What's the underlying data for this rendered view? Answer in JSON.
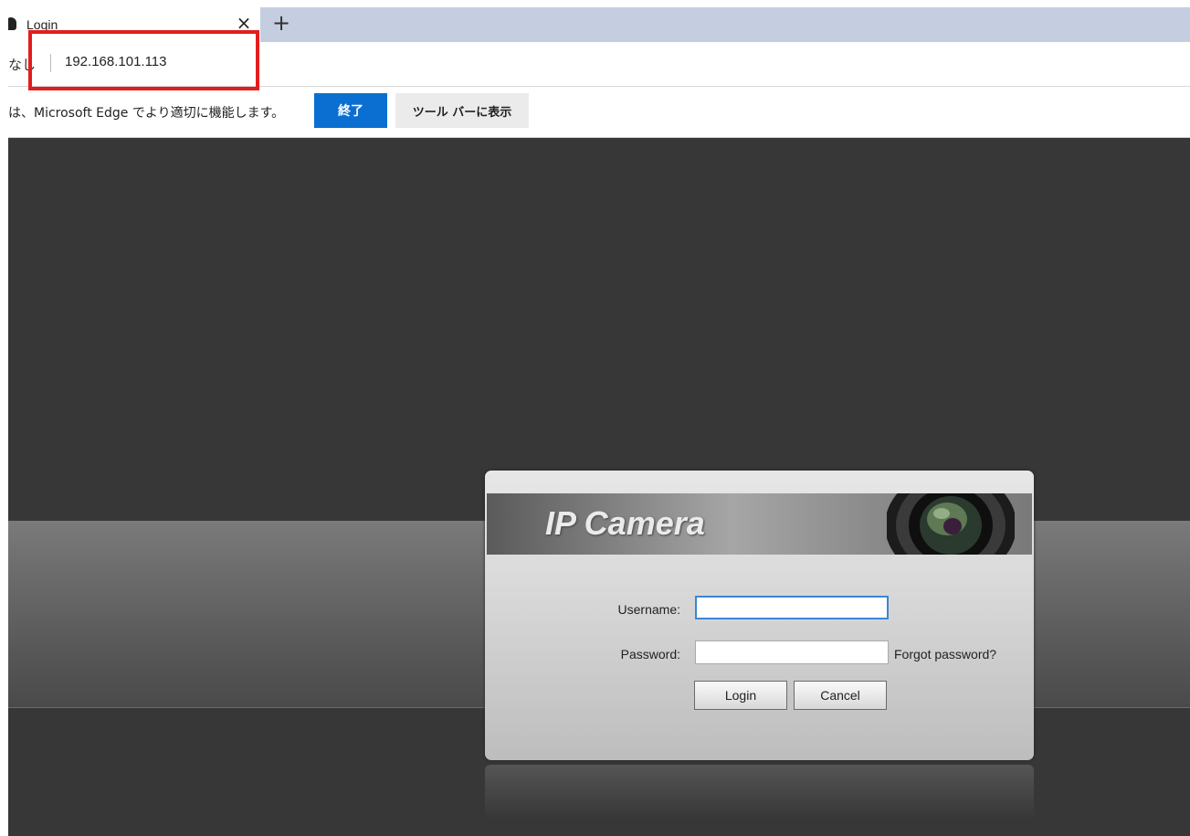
{
  "browser": {
    "tab": {
      "title": "Login",
      "close_glyph": "×"
    },
    "new_tab_glyph": "+",
    "address": {
      "security_label": "なし",
      "url": "192.168.101.113"
    },
    "infobar": {
      "message": "は、Microsoft Edge でより適切に機能します。",
      "end_button": "終了",
      "toolbar_button": "ツール バーに表示"
    }
  },
  "login": {
    "logo": "IP Camera",
    "username_label": "Username:",
    "username_value": "",
    "password_label": "Password:",
    "password_value": "",
    "forgot_link": "Forgot password?",
    "login_button": "Login",
    "cancel_button": "Cancel"
  },
  "colors": {
    "page_bg": "#373737",
    "highlight": "#e31d1d",
    "edge_accent": "#0a6fd1"
  }
}
